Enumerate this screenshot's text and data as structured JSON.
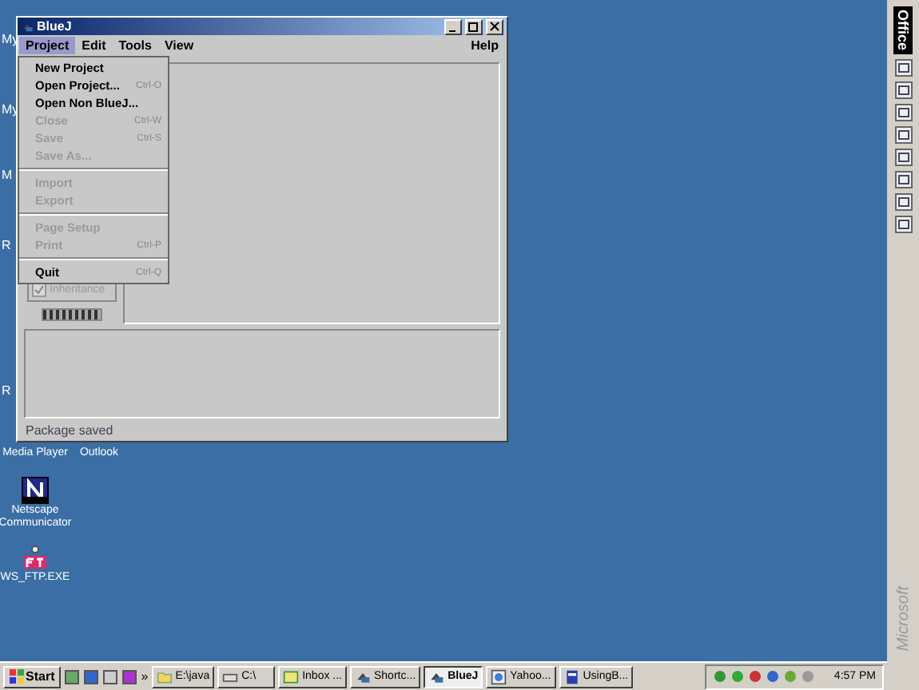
{
  "desktop": {
    "edge_labels": [
      "My",
      "My",
      "M",
      "R",
      "R"
    ],
    "icons": [
      {
        "kind": "media",
        "label": "Media Player"
      },
      {
        "kind": "outlook",
        "label": "Outlook"
      },
      {
        "kind": "netscape",
        "label": "Netscape Communicator"
      },
      {
        "kind": "ftp",
        "label": "WS_FTP.EXE"
      }
    ]
  },
  "window": {
    "title": "BlueJ",
    "menus": [
      {
        "label": "Project",
        "selected": true
      },
      {
        "label": "Edit",
        "selected": false
      },
      {
        "label": "Tools",
        "selected": false
      },
      {
        "label": "View",
        "selected": false
      }
    ],
    "help_menu": "Help",
    "dropdown": [
      {
        "kind": "item",
        "label": "New Project",
        "disabled": false
      },
      {
        "kind": "item",
        "label": "Open Project...",
        "shortcut": "Ctrl-O",
        "disabled": false
      },
      {
        "kind": "item",
        "label": "Open Non BlueJ...",
        "disabled": false
      },
      {
        "kind": "item",
        "label": "Close",
        "shortcut": "Ctrl-W",
        "disabled": true
      },
      {
        "kind": "item",
        "label": "Save",
        "shortcut": "Ctrl-S",
        "disabled": true
      },
      {
        "kind": "item",
        "label": "Save As...",
        "disabled": true
      },
      {
        "kind": "separator"
      },
      {
        "kind": "item",
        "label": "Import",
        "disabled": true
      },
      {
        "kind": "item",
        "label": "Export",
        "disabled": true
      },
      {
        "kind": "separator"
      },
      {
        "kind": "item",
        "label": "Page Setup",
        "disabled": true
      },
      {
        "kind": "item",
        "label": "Print",
        "shortcut": "Ctrl-P",
        "disabled": true
      },
      {
        "kind": "separator"
      },
      {
        "kind": "item",
        "label": "Quit",
        "shortcut": "Ctrl-Q",
        "disabled": false
      }
    ],
    "inheritance": {
      "label": "Inheritance",
      "checked": true,
      "disabled": true
    },
    "status": "Package saved"
  },
  "office_bar": {
    "title": "Office",
    "brand": "Microsoft"
  },
  "taskbar": {
    "start": "Start",
    "more": "»",
    "tasks": [
      {
        "label": "E:\\java",
        "kind": "folder",
        "selected": false
      },
      {
        "label": "C:\\",
        "kind": "drive",
        "selected": false
      },
      {
        "label": "Inbox ...",
        "kind": "mail",
        "selected": false
      },
      {
        "label": "Shortc...",
        "kind": "app",
        "selected": false
      },
      {
        "label": "BlueJ",
        "kind": "app",
        "selected": true
      },
      {
        "label": "Yahoo...",
        "kind": "browser",
        "selected": false
      },
      {
        "label": "UsingB...",
        "kind": "doc",
        "selected": false
      }
    ],
    "clock": "4:57 PM"
  }
}
